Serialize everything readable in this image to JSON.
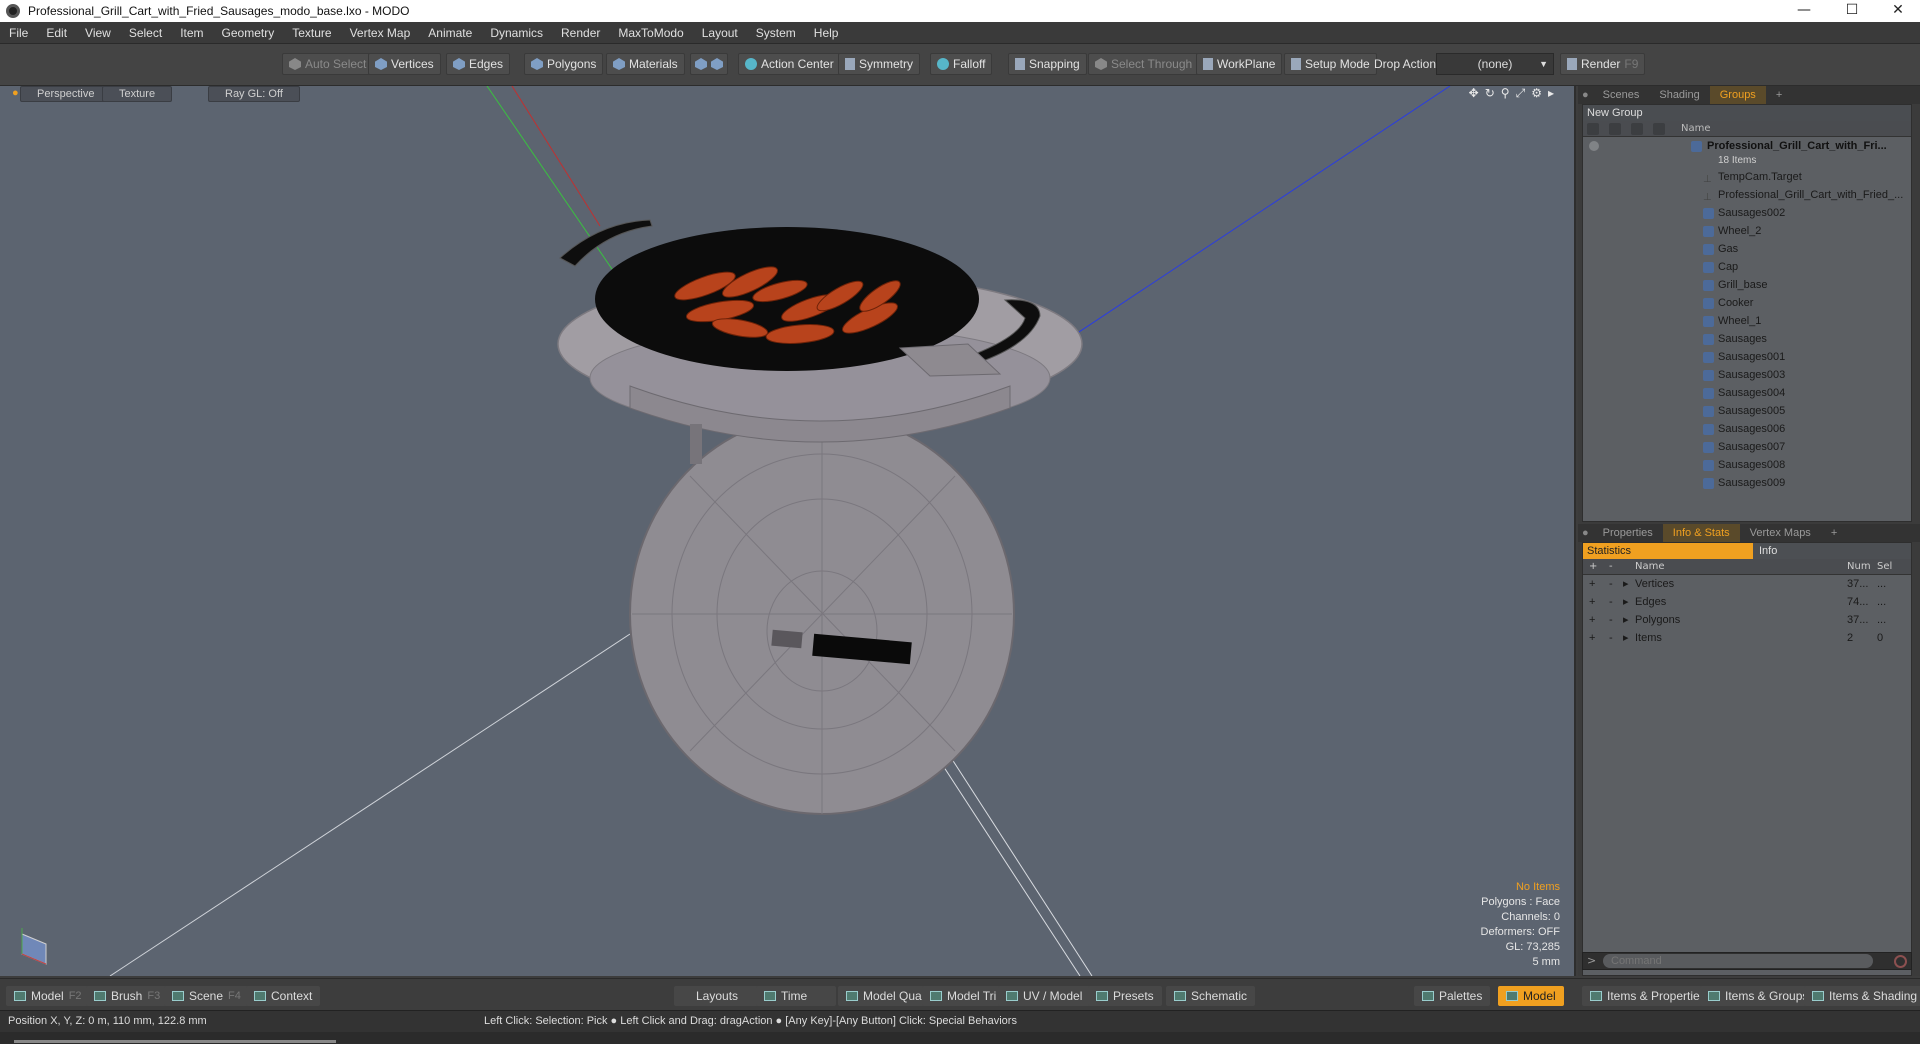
{
  "window": {
    "title": "Professional_Grill_Cart_with_Fried_Sausages_modo_base.lxo - MODO"
  },
  "menu": [
    "File",
    "Edit",
    "View",
    "Select",
    "Item",
    "Geometry",
    "Texture",
    "Vertex Map",
    "Animate",
    "Dynamics",
    "Render",
    "MaxToModo",
    "Layout",
    "System",
    "Help"
  ],
  "toolbar": {
    "auto_select": "Auto Select",
    "vertices": "Vertices",
    "edges": "Edges",
    "polygons": "Polygons",
    "materials": "Materials",
    "action_center": "Action Center",
    "symmetry": "Symmetry",
    "falloff": "Falloff",
    "snapping": "Snapping",
    "select_through": "Select Through",
    "workplane": "WorkPlane",
    "setup_mode": "Setup Mode",
    "drop_action": "Drop Action",
    "drop_value": "(none)",
    "render": "Render",
    "render_key": "F9"
  },
  "viewport": {
    "tabs": [
      "Perspective",
      "Texture",
      "Ray GL: Off"
    ],
    "info": {
      "no_items": "No Items",
      "polygons": "Polygons : Face",
      "channels": "Channels: 0",
      "deformers": "Deformers: OFF",
      "gl": "GL: 73,285",
      "scale": "5 mm"
    }
  },
  "scene_panel": {
    "tabs": [
      "Scenes",
      "Shading",
      "Groups"
    ],
    "active_tab": "Groups",
    "new_group": "New Group",
    "name_header": "Name",
    "root": {
      "name": "Professional_Grill_Cart_with_Fri...",
      "sub": "18 Items"
    },
    "items": [
      {
        "name": "TempCam.Target",
        "type": "locator"
      },
      {
        "name": "Professional_Grill_Cart_with_Fried_...",
        "type": "locator"
      },
      {
        "name": "Sausages002",
        "type": "mesh"
      },
      {
        "name": "Wheel_2",
        "type": "mesh"
      },
      {
        "name": "Gas",
        "type": "mesh"
      },
      {
        "name": "Cap",
        "type": "mesh"
      },
      {
        "name": "Grill_base",
        "type": "mesh"
      },
      {
        "name": "Cooker",
        "type": "mesh"
      },
      {
        "name": "Wheel_1",
        "type": "mesh"
      },
      {
        "name": "Sausages",
        "type": "mesh"
      },
      {
        "name": "Sausages001",
        "type": "mesh"
      },
      {
        "name": "Sausages003",
        "type": "mesh"
      },
      {
        "name": "Sausages004",
        "type": "mesh"
      },
      {
        "name": "Sausages005",
        "type": "mesh"
      },
      {
        "name": "Sausages006",
        "type": "mesh"
      },
      {
        "name": "Sausages007",
        "type": "mesh"
      },
      {
        "name": "Sausages008",
        "type": "mesh"
      },
      {
        "name": "Sausages009",
        "type": "mesh"
      }
    ]
  },
  "props_panel": {
    "tabs": [
      "Properties",
      "Info & Stats",
      "Vertex Maps"
    ],
    "active_tab": "Info & Stats",
    "statistics": "Statistics",
    "info": "Info",
    "cols": {
      "name": "Name",
      "num": "Num",
      "sel": "Sel"
    },
    "rows": [
      {
        "name": "Vertices",
        "num": "37...",
        "sel": "..."
      },
      {
        "name": "Edges",
        "num": "74...",
        "sel": "..."
      },
      {
        "name": "Polygons",
        "num": "37...",
        "sel": "..."
      },
      {
        "name": "Items",
        "num": "2",
        "sel": "0"
      }
    ]
  },
  "command": {
    "placeholder": "Command"
  },
  "bottom": {
    "model": "Model",
    "model_key": "F2",
    "brush": "Brush",
    "brush_key": "F3",
    "scene": "Scene",
    "scene_key": "F4",
    "context": "Context",
    "layouts": "Layouts",
    "time": "Time",
    "model_quad": "Model Quad",
    "model_tri": "Model Tri",
    "uv_model": "UV / Model",
    "presets": "Presets",
    "schematic": "Schematic",
    "palettes": "Palettes",
    "model_active": "Model",
    "items_properties": "Items & Properties",
    "items_groups": "Items & Groups",
    "items_shading": "Items & Shading"
  },
  "status": {
    "position": "Position X, Y, Z:  0 m, 110 mm, 122.8 mm",
    "hint": "Left Click: Selection: Pick ●  Left Click and Drag: dragAction ●  [Any Key]-[Any Button] Click: Special Behaviors"
  },
  "colors": {
    "accent": "#f0a020",
    "viewport_bg": "#5c6470",
    "mesh_icon": "#4c6a99"
  }
}
